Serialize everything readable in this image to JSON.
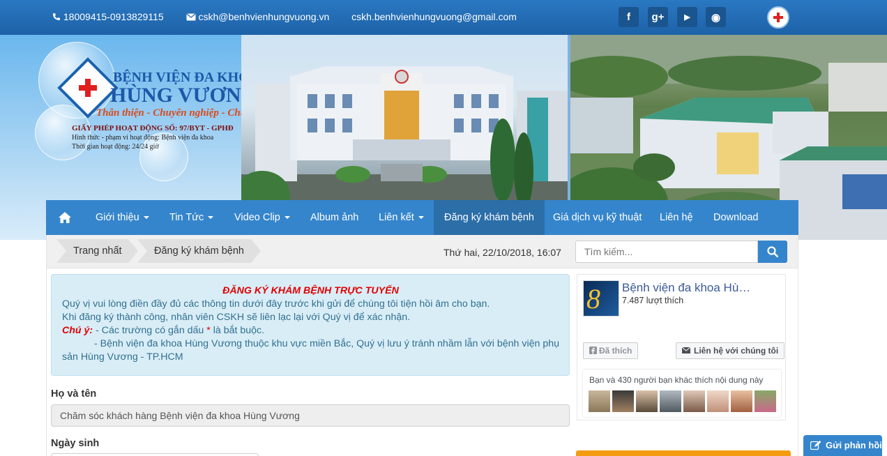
{
  "topbar": {
    "phone": "18009415-0913829115",
    "email1": "cskh@benhvienhungvuong.vn",
    "email2": "cskh.benhvienhungvuong@gmail.com",
    "social": [
      {
        "icon": "facebook-icon",
        "glyph": "f"
      },
      {
        "icon": "google-plus-icon",
        "glyph": "g+"
      },
      {
        "icon": "youtube-icon",
        "glyph": "▶"
      },
      {
        "icon": "rss-icon",
        "glyph": "◉"
      }
    ]
  },
  "banner": {
    "line1": "BỆNH VIỆN ĐA KHOA",
    "line2": "HÙNG VƯƠNG",
    "slogan": "Thân thiện - Chuyên nghiệp - Chu đáo",
    "license": "GIẤY PHÉP HOẠT ĐỘNG SỐ: 97/BYT - GPHĐ",
    "scope": "Hình thức - phạm vi hoạt động: Bệnh viện đa khoa",
    "hours": "Thời gian hoạt động: 24/24 giờ"
  },
  "nav": {
    "items": [
      {
        "label": "Giới thiệu",
        "dropdown": true
      },
      {
        "label": "Tin Tức",
        "dropdown": true
      },
      {
        "label": "Video Clip",
        "dropdown": true
      },
      {
        "label": "Album ảnh",
        "dropdown": false
      },
      {
        "label": "Liên kết",
        "dropdown": true
      },
      {
        "label": "Đăng ký khám bệnh",
        "dropdown": false,
        "active": true
      },
      {
        "label": "Giá dịch vụ kỹ thuật",
        "dropdown": false
      },
      {
        "label": "Liên hệ",
        "dropdown": false
      },
      {
        "label": "Download",
        "dropdown": false
      }
    ]
  },
  "breadcrumb": {
    "items": [
      "Trang nhất",
      "Đăng ký khám bệnh"
    ]
  },
  "datetime": "Thứ hai, 22/10/2018, 16:07",
  "search": {
    "placeholder": "Tìm kiếm..."
  },
  "notice": {
    "title": "ĐĂNG KÝ KHÁM BỆNH TRỰC TUYẾN",
    "line1": "Quý vị vui lòng điền đầy đủ các thông tin dưới đây trước khi gửi để chúng tôi tiện hồi âm cho bạn.",
    "line2": "Khi đăng ký thành công, nhân viên CSKH sẽ liên lạc lại với Quý vị để xác nhận.",
    "note_label": "Chú ý:",
    "note1_a": " - Các trường có gắn dấu ",
    "note1_star": "*",
    "note1_b": " là bắt buộc.",
    "note2": "- Bệnh viện đa khoa Hùng Vương thuộc khu vực miền Bắc, Quý vị lưu ý tránh nhầm lẫn với bệnh viện phụ sản Hùng Vương - TP.HCM"
  },
  "form": {
    "name_label": "Họ và tên",
    "name_value": "Chăm sóc khách hàng Bệnh viện đa khoa Hùng Vương",
    "dob_label": "Ngày sinh"
  },
  "facebook": {
    "page_name": "Bệnh viện đa khoa Hù…",
    "likes": "7.487 lượt thích",
    "liked_button": "Đã thích",
    "contact_button": "Liên hệ với chúng tôi",
    "friends_text": "Bạn và 430 người bạn khác thích nội dung này"
  },
  "feedback_button": "Gửi phản hồi",
  "colors": {
    "primary_blue": "#3585cc",
    "alert_bg": "#d9edf7",
    "alert_text": "#31708f",
    "required_red": "#e00000",
    "facebook_blue": "#3b5998"
  }
}
